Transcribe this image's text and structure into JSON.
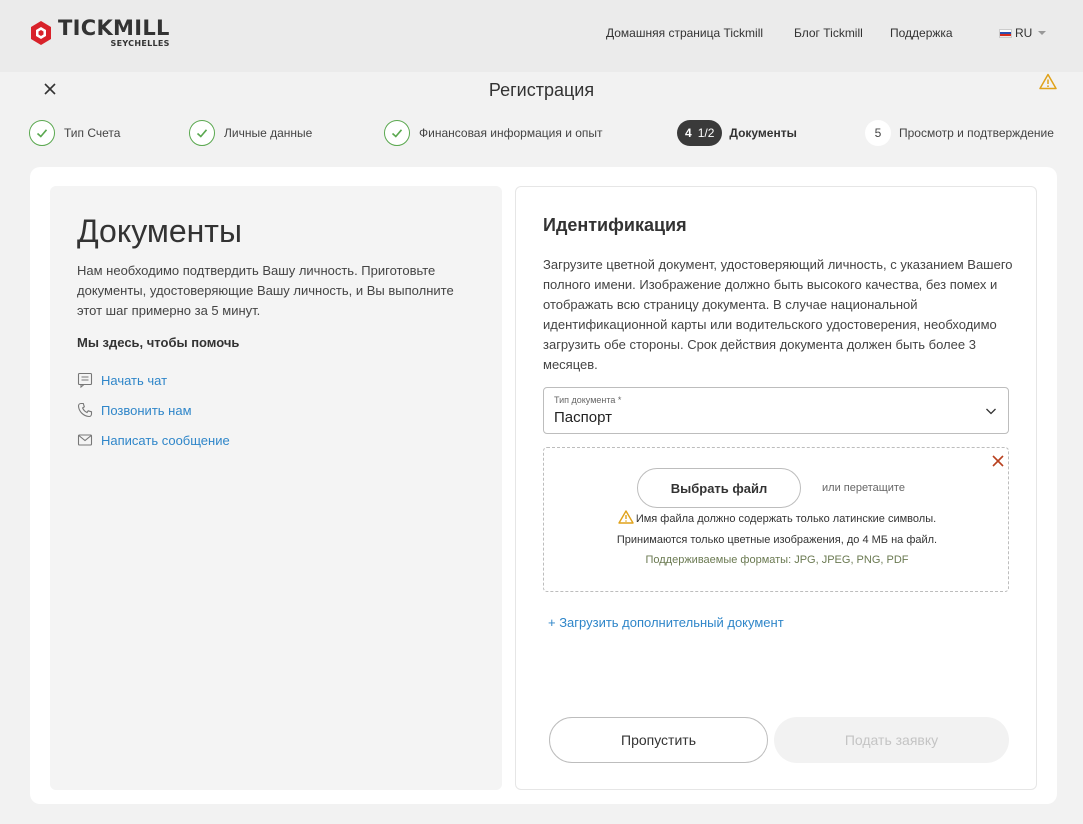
{
  "header": {
    "brand": "TICKMILL",
    "brand_sub": "SEYCHELLES",
    "nav": [
      "Домашняя страница Tickmill",
      "Блог Tickmill",
      "Поддержка"
    ],
    "language": "RU"
  },
  "page": {
    "title": "Регистрация"
  },
  "steps": [
    {
      "label": "Тип Счета",
      "state": "done"
    },
    {
      "label": "Личные данные",
      "state": "done"
    },
    {
      "label": "Финансовая информация и опыт",
      "state": "done"
    },
    {
      "number": "4",
      "progress": "1/2",
      "label": "Документы",
      "state": "active"
    },
    {
      "number": "5",
      "label": "Просмотр и подтверждение",
      "state": "pending"
    }
  ],
  "left": {
    "title": "Документы",
    "description": "Нам необходимо подтвердить Вашу личность. Приготовьте документы, удостоверяющие Вашу личность, и Вы выполните этот шаг примерно за 5 минут.",
    "help_heading": "Мы здесь, чтобы помочь",
    "help_items": [
      "Начать чат",
      "Позвонить нам",
      "Написать сообщение"
    ]
  },
  "right": {
    "title": "Идентификация",
    "description": "Загрузите цветной документ, удостоверяющий личность, с указанием Вашего полного имени. Изображение должно быть высокого качества, без помех и отображать всю страницу документа. В случае национальной идентификационной карты или водительского удостоверения, необходимо загрузить обе стороны. Срок действия документа должен быть более 3 месяцев.",
    "doc_type_label": "Тип документа *",
    "doc_type_value": "Паспорт",
    "choose_file": "Выбрать файл",
    "or_drag": "или перетащите",
    "warning": "Имя файла должно содержать только латинские символы.",
    "info": "Принимаются только цветные изображения, до 4 МБ на файл.",
    "formats": "Поддерживаемые форматы: JPG, JPEG, PNG, PDF",
    "add_document": "+ Загрузить дополнительный документ",
    "skip": "Пропустить",
    "submit": "Подать заявку"
  },
  "colors": {
    "accent_link": "#2f86c9",
    "check_green": "#5aa84f",
    "warning": "#e0a21a",
    "error_x": "#b8401f",
    "brand_red": "#d8222a"
  }
}
